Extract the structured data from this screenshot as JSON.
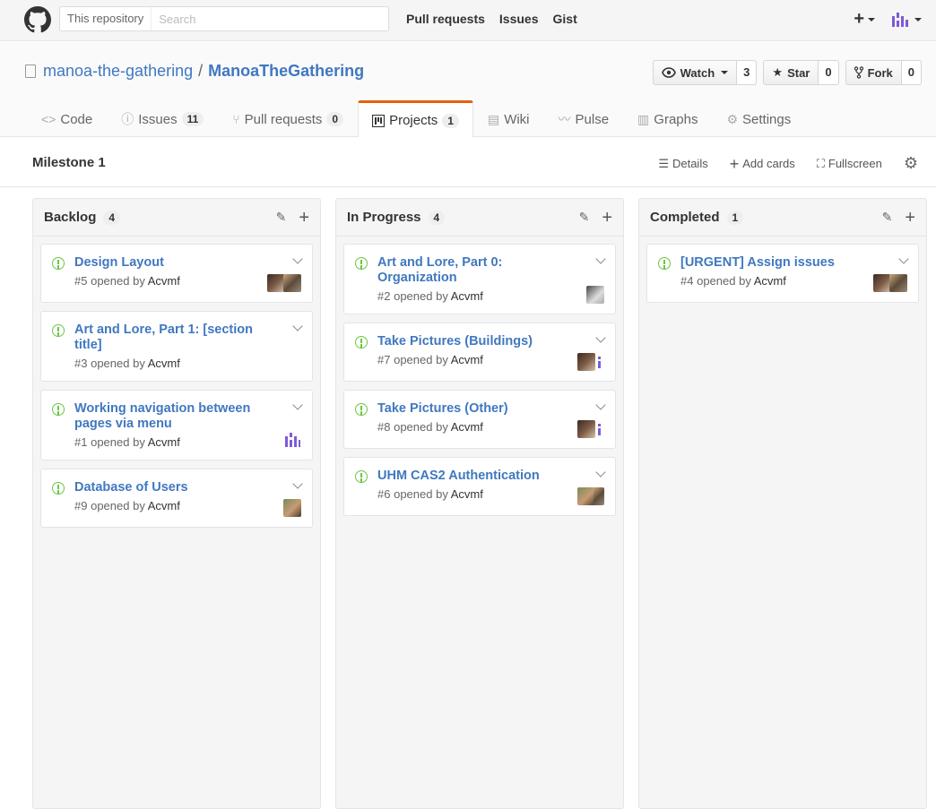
{
  "header": {
    "search_scope": "This repository",
    "search_placeholder": "Search",
    "nav": [
      "Pull requests",
      "Issues",
      "Gist"
    ],
    "create_label": "+"
  },
  "repo": {
    "owner": "manoa-the-gathering",
    "separator": "/",
    "name": "ManoaTheGathering",
    "actions": {
      "watch": {
        "label": "Watch",
        "count": "3"
      },
      "star": {
        "label": "Star",
        "count": "0"
      },
      "fork": {
        "label": "Fork",
        "count": "0"
      }
    },
    "tabs": [
      {
        "label": "Code",
        "icon": "code-icon",
        "counter": ""
      },
      {
        "label": "Issues",
        "icon": "issue-opened-icon",
        "counter": "11"
      },
      {
        "label": "Pull requests",
        "icon": "git-pull-request-icon",
        "counter": "0"
      },
      {
        "label": "Projects",
        "icon": "project-icon",
        "counter": "1",
        "selected": true
      },
      {
        "label": "Wiki",
        "icon": "book-icon",
        "counter": ""
      },
      {
        "label": "Pulse",
        "icon": "pulse-icon",
        "counter": ""
      },
      {
        "label": "Graphs",
        "icon": "graph-icon",
        "counter": ""
      },
      {
        "label": "Settings",
        "icon": "gear-icon",
        "counter": ""
      }
    ]
  },
  "project": {
    "name": "Milestone 1",
    "actions": {
      "details": "Details",
      "add_cards": "Add cards",
      "fullscreen": "Fullscreen"
    }
  },
  "columns": [
    {
      "title": "Backlog",
      "count": "4",
      "cards": [
        {
          "title": "Design Layout",
          "number": "#5",
          "opened_by": "opened by",
          "author": "Acvmf",
          "assignees": [
            "photo1",
            "photo2"
          ]
        },
        {
          "title": "Art and Lore, Part 1: [section title]",
          "number": "#3",
          "opened_by": "opened by",
          "author": "Acvmf",
          "assignees": []
        },
        {
          "title": "Working navigation between pages via menu",
          "number": "#1",
          "opened_by": "opened by",
          "author": "Acvmf",
          "assignees": [
            "ident"
          ]
        },
        {
          "title": "Database of Users",
          "number": "#9",
          "opened_by": "opened by",
          "author": "Acvmf",
          "assignees": [
            "photo4"
          ]
        }
      ]
    },
    {
      "title": "In Progress",
      "count": "4",
      "cards": [
        {
          "title": "Art and Lore, Part 0: Organization",
          "number": "#2",
          "opened_by": "opened by",
          "author": "Acvmf",
          "assignees": [
            "photo3"
          ]
        },
        {
          "title": "Take Pictures (Buildings)",
          "number": "#7",
          "opened_by": "opened by",
          "author": "Acvmf",
          "assignees": [
            "photo1",
            "ident"
          ]
        },
        {
          "title": "Take Pictures (Other)",
          "number": "#8",
          "opened_by": "opened by",
          "author": "Acvmf",
          "assignees": [
            "photo1",
            "ident"
          ]
        },
        {
          "title": "UHM CAS2 Authentication",
          "number": "#6",
          "opened_by": "opened by",
          "author": "Acvmf",
          "assignees": [
            "photo4",
            "photo2"
          ]
        }
      ]
    },
    {
      "title": "Completed",
      "count": "1",
      "cards": [
        {
          "title": "[URGENT] Assign issues",
          "number": "#4",
          "opened_by": "opened by",
          "author": "Acvmf",
          "assignees": [
            "photo1",
            "photo2"
          ]
        }
      ]
    }
  ],
  "colors": {
    "link": "#4078c0",
    "issue_open": "#6cc644",
    "selected_tab_accent": "#e36209",
    "identicon": "#7c5cd6"
  }
}
